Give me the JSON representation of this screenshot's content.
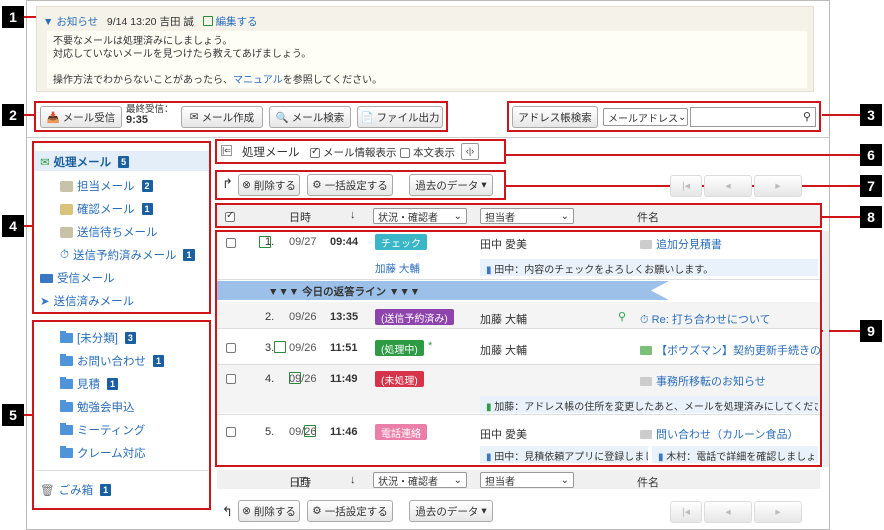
{
  "markers": [
    "1",
    "2",
    "3",
    "4",
    "5",
    "6",
    "7",
    "8",
    "9"
  ],
  "notice": {
    "toggle_arrow": "▼",
    "label": "お知らせ",
    "date": "9/14 13:20",
    "author": "吉田 誠",
    "edit": "編集する",
    "line1": "不要なメールは処理済みにしましょう。",
    "line2": "対応していないメールを見つけたら教えてあげましょう。",
    "line3_pre": "操作方法でわからないことがあったら、",
    "line3_link": "マニュアル",
    "line3_post": "を参照してください。"
  },
  "toolbar": {
    "receive": "メール受信",
    "last_recv_label": "最終受信：",
    "last_recv_time": "9:35",
    "compose": "メール作成",
    "search": "メール検索",
    "export": "ファイル出力"
  },
  "addressbook": {
    "button": "アドレス帳検索",
    "select": "メールアドレス",
    "search_placeholder": ""
  },
  "sidebar": {
    "processing": {
      "label": "処理メール",
      "count": "5"
    },
    "assignee": {
      "label": "担当メール",
      "count": "2"
    },
    "confirm": {
      "label": "確認メール",
      "count": "1"
    },
    "waiting": {
      "label": "送信待ちメール"
    },
    "scheduled": {
      "label": "送信予約済みメール",
      "count": "1"
    },
    "inbox": {
      "label": "受信メール"
    },
    "sent": {
      "label": "送信済みメール"
    },
    "folders": [
      {
        "label": "[未分類]",
        "count": "3"
      },
      {
        "label": "お問い合わせ",
        "count": "1"
      },
      {
        "label": "見積",
        "count": "1"
      },
      {
        "label": "勉強会申込"
      },
      {
        "label": "ミーティング"
      },
      {
        "label": "クレーム対応"
      }
    ],
    "trash": {
      "label": "ごみ箱",
      "count": "1"
    }
  },
  "view": {
    "title": "処理メール",
    "opt_info": "メール情報表示",
    "opt_body": "本文表示",
    "toggle": "‹|›"
  },
  "actions": {
    "delete": "削除する",
    "bulk": "一括設定する",
    "past": "過去のデータ"
  },
  "pager": {
    "first": "|◂",
    "prev": "◂",
    "next": "▸"
  },
  "table": {
    "headers": {
      "date": "日時",
      "sort_arrow": "↓",
      "status": "状況・確認者",
      "assignee": "担当者",
      "subject": "件名"
    },
    "divider": "▼▼▼ 今日の返答ライン ▼▼▼",
    "rows": [
      {
        "num": "1.",
        "date": "09/27",
        "time": "09:44",
        "tag": "チェック",
        "confirmer": "加藤 大輔",
        "assignee": "田中 愛美",
        "subject": "追加分見積書",
        "memo": "田中：内容のチェックをよろしくお願いします。"
      },
      {
        "num": "2.",
        "date": "09/26",
        "time": "13:35",
        "tag": "(送信予約済み)",
        "assignee": "加藤 大輔",
        "subject": "Re: 打ち合わせについて"
      },
      {
        "num": "3.",
        "date": "09/26",
        "time": "11:51",
        "tag": "(処理中)",
        "star": "*",
        "assignee": "加藤 大輔",
        "subject": "【ボウズマン】契約更新手続きのお願い"
      },
      {
        "num": "4.",
        "date": "09/26",
        "time": "11:49",
        "tag": "(未処理)",
        "subject": "事務所移転のお知らせ",
        "memo": "加藤：アドレス帳の住所を変更したあと、メールを処理済みにしてください。"
      },
      {
        "num": "5.",
        "date": "09/26",
        "time": "11:46",
        "tag": "電話連絡",
        "assignee": "田中 愛美",
        "subject": "問い合わせ（カルーン食品）",
        "memo": "田中：見積依頼アプリに登録しました。",
        "memo2": "木村：電話で詳細を確認しましょう。"
      }
    ]
  },
  "colors": {
    "check": "#39b7c7",
    "scheduled": "#8e44ad",
    "processing": "#2e9b45",
    "unprocessed": "#d7334a",
    "phone": "#ea7fa9",
    "marker_border": "#d0151a",
    "link": "#2a6ebb"
  }
}
